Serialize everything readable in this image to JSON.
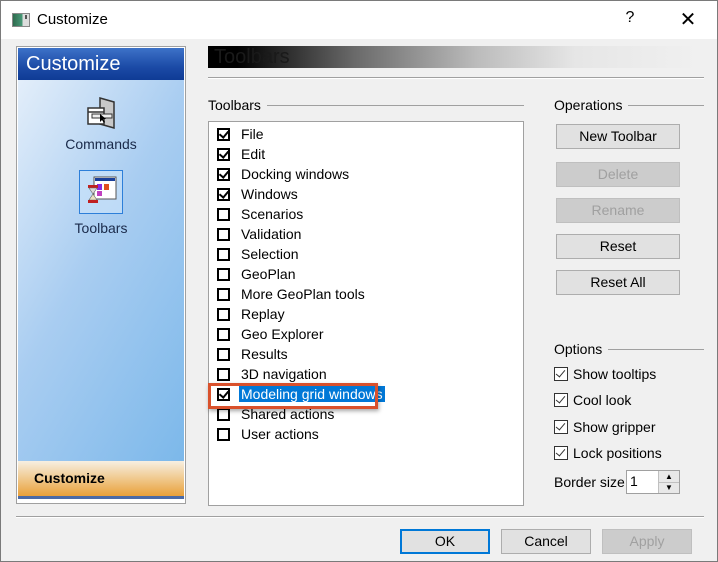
{
  "window": {
    "title": "Customize",
    "help_label": "?",
    "close_label": "✕",
    "app_icon": "window-icon"
  },
  "sidebar": {
    "header": "Customize",
    "items": [
      {
        "label": "Commands",
        "icon": "commands-icon",
        "selected": false
      },
      {
        "label": "Toolbars",
        "icon": "toolbars-icon",
        "selected": true
      }
    ],
    "footer": "Customize"
  },
  "banner": {
    "title": "Toolbars"
  },
  "toolbars_group": {
    "label": "Toolbars",
    "items": [
      {
        "label": "File",
        "checked": true
      },
      {
        "label": "Edit",
        "checked": true
      },
      {
        "label": "Docking windows",
        "checked": true
      },
      {
        "label": "Windows",
        "checked": true
      },
      {
        "label": "Scenarios",
        "checked": false
      },
      {
        "label": "Validation",
        "checked": false
      },
      {
        "label": "Selection",
        "checked": false
      },
      {
        "label": "GeoPlan",
        "checked": false
      },
      {
        "label": "More GeoPlan tools",
        "checked": false
      },
      {
        "label": "Replay",
        "checked": false
      },
      {
        "label": "Geo Explorer",
        "checked": false
      },
      {
        "label": "Results",
        "checked": false
      },
      {
        "label": "3D navigation",
        "checked": false
      },
      {
        "label": "Modeling grid windows",
        "checked": true,
        "selected": true
      },
      {
        "label": "Shared actions",
        "checked": false
      },
      {
        "label": "User actions",
        "checked": false
      }
    ]
  },
  "operations": {
    "label": "Operations",
    "buttons": [
      {
        "label": "New Toolbar",
        "enabled": true
      },
      {
        "label": "Delete",
        "enabled": false
      },
      {
        "label": "Rename",
        "enabled": false
      },
      {
        "label": "Reset",
        "enabled": true
      },
      {
        "label": "Reset All",
        "enabled": true
      }
    ]
  },
  "options": {
    "label": "Options",
    "checkboxes": [
      {
        "label": "Show tooltips",
        "checked": true
      },
      {
        "label": "Cool look",
        "checked": true
      },
      {
        "label": "Show gripper",
        "checked": true
      },
      {
        "label": "Lock positions",
        "checked": true
      }
    ],
    "border_size_label": "Border size",
    "border_size_value": "1"
  },
  "footer": {
    "ok": "OK",
    "cancel": "Cancel",
    "apply": "Apply"
  },
  "colors": {
    "selection": "#0078d7",
    "highlight_box": "#d9512c",
    "sidebar_header": "#1b4aa6",
    "sidebar_footer": "#e9a03a"
  }
}
